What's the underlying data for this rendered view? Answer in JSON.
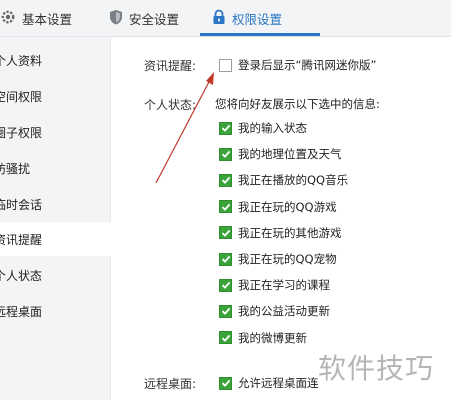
{
  "tabs": [
    {
      "label": "基本设置",
      "icon": "gear-icon"
    },
    {
      "label": "安全设置",
      "icon": "shield-icon"
    },
    {
      "label": "权限设置",
      "icon": "lock-icon"
    }
  ],
  "accent_color": "#2b77c5",
  "check_color": "#3aa33a",
  "sidebar": {
    "items": [
      {
        "label": "个人资料"
      },
      {
        "label": "空间权限"
      },
      {
        "label": "圈子权限"
      },
      {
        "label": "防骚扰"
      },
      {
        "label": "临时会话"
      },
      {
        "label": "资讯提醒",
        "selected": true
      },
      {
        "label": "个人状态"
      },
      {
        "label": "远程桌面"
      }
    ]
  },
  "news": {
    "label": "资讯提醒:",
    "option": "登录后显示“腾讯网迷你版”",
    "checked": false
  },
  "status": {
    "label": "个人状态:",
    "description": "您将向好友展示以下选中的信息:",
    "options": [
      {
        "label": "我的输入状态",
        "checked": true
      },
      {
        "label": "我的地理位置及天气",
        "checked": true
      },
      {
        "label": "我正在播放的QQ音乐",
        "checked": true
      },
      {
        "label": "我正在玩的QQ游戏",
        "checked": true
      },
      {
        "label": "我正在玩的其他游戏",
        "checked": true
      },
      {
        "label": "我正在玩的QQ宠物",
        "checked": true
      },
      {
        "label": "我正在学习的课程",
        "checked": true
      },
      {
        "label": "我的公益活动更新",
        "checked": true
      },
      {
        "label": "我的微博更新",
        "checked": true
      }
    ]
  },
  "remote": {
    "label": "远程桌面:",
    "option": "允许远程桌面连",
    "checked": true
  },
  "watermark": "软件技巧"
}
